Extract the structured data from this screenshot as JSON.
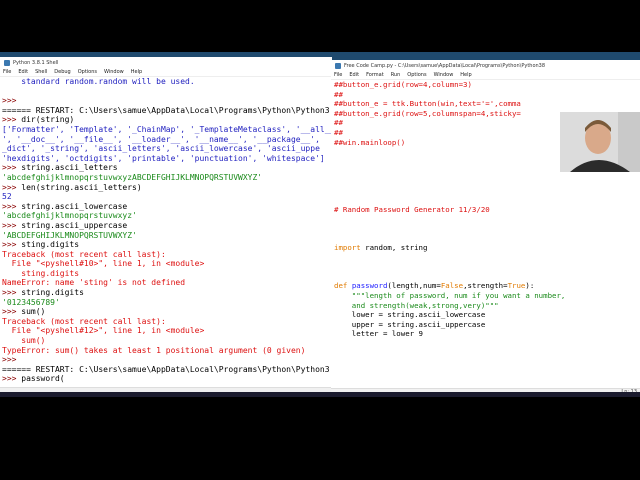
{
  "shell": {
    "title": "Python 3.8.1 Shell",
    "menu": [
      "File",
      "Edit",
      "Shell",
      "Debug",
      "Options",
      "Window",
      "Help"
    ],
    "lines": [
      {
        "t": "out",
        "text": "    standard random.random will be used."
      },
      {
        "t": "out",
        "text": ""
      },
      {
        "t": "prompt",
        "text": ">>>"
      },
      {
        "t": "restart",
        "text": "====== RESTART: C:\\Users\\samue\\AppData\\Local\\Programs\\Python\\Python3"
      },
      {
        "t": "cmd",
        "text": ">>> dir(string)"
      },
      {
        "t": "out",
        "text": "['Formatter', 'Template', '_ChainMap', '_TemplateMetaclass', '__all__"
      },
      {
        "t": "out",
        "text": "', '__doc__', '__file__', '__loader__', '__name__', '__package__',"
      },
      {
        "t": "out",
        "text": "_dict', '_string', 'ascii_letters', 'ascii_lowercase', 'ascii_uppe"
      },
      {
        "t": "out",
        "text": "'hexdigits', 'octdigits', 'printable', 'punctuation', 'whitespace']"
      },
      {
        "t": "cmd",
        "text": ">>> string.ascii_letters"
      },
      {
        "t": "str",
        "text": "'abcdefghijklmnopqrstuvwxyzABCDEFGHIJKLMNOPQRSTUVWXYZ'"
      },
      {
        "t": "cmd",
        "text": ">>> len(string.ascii_letters)"
      },
      {
        "t": "out",
        "text": "52"
      },
      {
        "t": "cmd",
        "text": ">>> string.ascii_lowercase"
      },
      {
        "t": "str",
        "text": "'abcdefghijklmnopqrstuvwxyz'"
      },
      {
        "t": "cmd",
        "text": ">>> string.ascii_uppercase"
      },
      {
        "t": "str",
        "text": "'ABCDEFGHIJKLMNOPQRSTUVWXYZ'"
      },
      {
        "t": "cmd",
        "text": ">>> sting.digits"
      },
      {
        "t": "err",
        "text": "Traceback (most recent call last):"
      },
      {
        "t": "err",
        "text": "  File \"<pyshell#10>\", line 1, in <module>"
      },
      {
        "t": "err",
        "text": "    sting.digits"
      },
      {
        "t": "err",
        "text": "NameError: name 'sting' is not defined"
      },
      {
        "t": "cmd",
        "text": ">>> string.digits"
      },
      {
        "t": "str",
        "text": "'0123456789'"
      },
      {
        "t": "cmd",
        "text": ">>> sum()"
      },
      {
        "t": "err",
        "text": "Traceback (most recent call last):"
      },
      {
        "t": "err",
        "text": "  File \"<pyshell#12>\", line 1, in <module>"
      },
      {
        "t": "err",
        "text": "    sum()"
      },
      {
        "t": "err",
        "text": "TypeError: sum() takes at least 1 positional argument (0 given)"
      },
      {
        "t": "prompt",
        "text": ">>>"
      },
      {
        "t": "restart",
        "text": "====== RESTART: C:\\Users\\samue\\AppData\\Local\\Programs\\Python\\Python3"
      },
      {
        "t": "cmd",
        "text": ">>> password("
      }
    ]
  },
  "editor": {
    "title": "Free Code Camp.py - C:\\Users\\samue\\AppData\\Local\\Programs\\Python\\Python38",
    "menu": [
      "File",
      "Edit",
      "Format",
      "Run",
      "Options",
      "Window",
      "Help"
    ],
    "lines": [
      {
        "t": "comment",
        "text": "##button_e.grid(row=4,column=3)"
      },
      {
        "t": "comment",
        "text": "##"
      },
      {
        "t": "comment",
        "text": "##button_e = ttk.Button(win,text='=',comma"
      },
      {
        "t": "comment",
        "text": "##button_e.grid(row=5,columnspan=4,sticky="
      },
      {
        "t": "comment",
        "text": "##"
      },
      {
        "t": "comment",
        "text": "##"
      },
      {
        "t": "comment",
        "text": "##win.mainloop()"
      },
      {
        "t": "blank",
        "text": ""
      },
      {
        "t": "blank",
        "text": ""
      },
      {
        "t": "blank",
        "text": ""
      },
      {
        "t": "blank",
        "text": ""
      },
      {
        "t": "blank",
        "text": ""
      },
      {
        "t": "blank",
        "text": ""
      },
      {
        "t": "comment",
        "text": "# Random Password Generator 11/3/20"
      },
      {
        "t": "blank",
        "text": ""
      },
      {
        "t": "blank",
        "text": ""
      },
      {
        "t": "blank",
        "text": ""
      },
      {
        "t": "import",
        "text": "import random, string"
      },
      {
        "t": "blank",
        "text": ""
      },
      {
        "t": "blank",
        "text": ""
      },
      {
        "t": "blank",
        "text": ""
      },
      {
        "t": "def",
        "text": "def password(length,num=False,strength=True):"
      },
      {
        "t": "str",
        "text": "    \"\"\"length of password, num if you want a number,"
      },
      {
        "t": "str",
        "text": "    and strength(weak,strong,very)\"\"\""
      },
      {
        "t": "code",
        "text": "    lower = string.ascii_lowercase"
      },
      {
        "t": "code",
        "text": "    upper = string.ascii_uppercase"
      },
      {
        "t": "code",
        "text": "    letter = lower 9"
      }
    ],
    "status": "Ln: 13"
  }
}
